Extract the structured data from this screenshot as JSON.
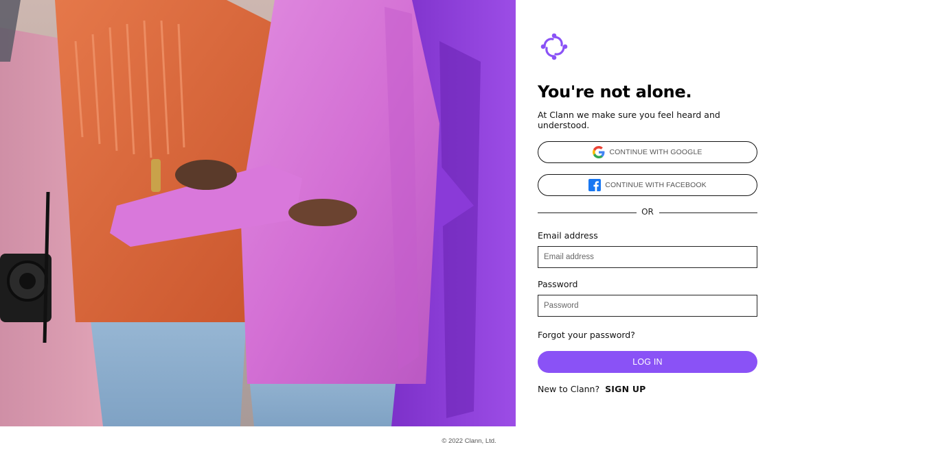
{
  "brand": {
    "name": "Clann",
    "logo_icon": "clann-logo-icon",
    "accent_color": "#8a52f6"
  },
  "hero": {
    "image_description": "group-hug-photo"
  },
  "login": {
    "headline": "You're not alone.",
    "subtitle": "At Clann we make sure you feel heard and understood.",
    "google_button": "CONTINUE WITH GOOGLE",
    "facebook_button": "CONTINUE WITH FACEBOOK",
    "divider_text": "OR",
    "email_label": "Email address",
    "email_placeholder": "Email address",
    "email_value": "",
    "password_label": "Password",
    "password_placeholder": "Password",
    "password_value": "",
    "forgot_password": "Forgot your password?",
    "login_button": "LOG IN",
    "signup_prompt": "New to Clann?",
    "signup_link": "SIGN UP"
  },
  "footer": {
    "copyright": "© 2022 Clann, Ltd."
  }
}
